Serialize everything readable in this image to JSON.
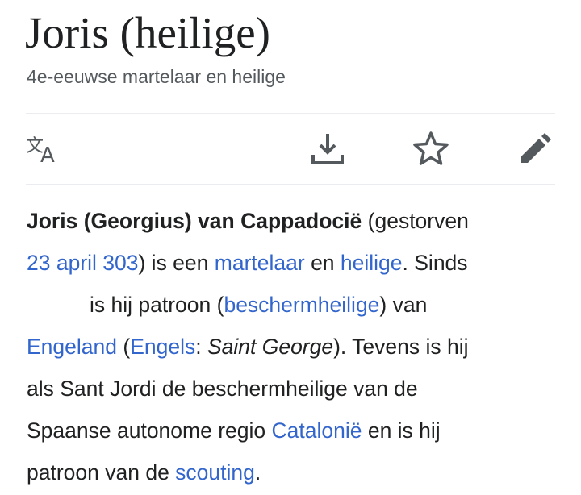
{
  "article": {
    "title": "Joris (heilige)",
    "description": "4e-eeuwse martelaar en heilige"
  },
  "toolbar": {
    "language_icon": "translate-icon",
    "download_icon": "download-icon",
    "watch_icon": "star-icon",
    "edit_icon": "pencil-icon",
    "icon_color": "#54595d"
  },
  "lead": {
    "l1_bold": "Joris (Georgius) van Cappadocië",
    "l1_text": " (gestorven",
    "l2_link_date": "23 april 303",
    "l2_text_a": ") is een ",
    "l2_link_martelaar": "martelaar",
    "l2_text_b": " en ",
    "l2_link_heilige": "heilige",
    "l2_text_c": ". Sinds",
    "l3_text_a": "is hij patroon (",
    "l3_link_beschermheilige": "beschermheilige",
    "l3_text_b": ") van",
    "l4_link_engeland": "Engeland",
    "l4_text_a": " (",
    "l4_link_engels": "Engels",
    "l4_text_b": ": ",
    "l4_italic": "Saint George",
    "l4_text_c": "). Tevens is hij",
    "l5_text": "als Sant Jordi de beschermheilige van de",
    "l6_text_a": "Spaanse autonome regio ",
    "l6_link_catalonie": "Catalonië",
    "l6_text_b": " en is hij",
    "l7_text_a": "patroon van de ",
    "l7_link_scouting": "scouting",
    "l7_text_b": ".",
    "link_color": "#3366cc"
  }
}
